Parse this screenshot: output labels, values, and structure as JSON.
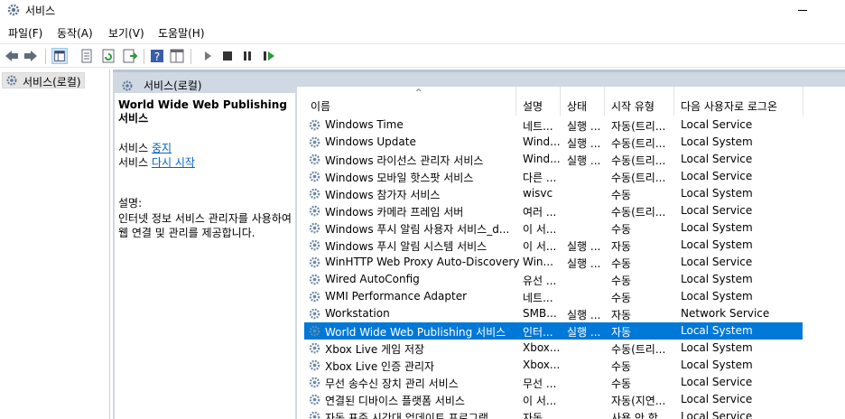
{
  "window": {
    "title": "서비스",
    "icon": "gear-icon"
  },
  "menu": [
    "파일(F)",
    "동작(A)",
    "보기(V)",
    "도움말(H)"
  ],
  "toolbar": [
    "back-arrow-icon",
    "forward-arrow-icon",
    "console-tree-icon",
    "properties-icon",
    "refresh-icon",
    "export-list-icon",
    "help-icon",
    "view-icon",
    "start-icon",
    "stop-icon",
    "pause-icon",
    "restart-icon"
  ],
  "tree": {
    "root_label": "서비스(로컬)"
  },
  "pane": {
    "title": "서비스(로컬)"
  },
  "extended": {
    "service_name": "World Wide Web Publishing 서비스",
    "action_prefix": "서비스",
    "stop_link": "중지",
    "restart_link": "다시 시작",
    "desc_label": "설명:",
    "description": "인터넷 정보 서비스 관리자를 사용하여 웹 연결 및 관리를 제공합니다."
  },
  "columns": {
    "name": "이름",
    "desc": "설명",
    "status": "상태",
    "startup": "시작 유형",
    "logon": "다음 사용자로 로그온"
  },
  "rows": [
    {
      "name": "Windows Time",
      "desc": "네트...",
      "status": "실행 ...",
      "startup": "자동(트리...",
      "logon": "Local Service"
    },
    {
      "name": "Windows Update",
      "desc": "Wind...",
      "status": "실행 ...",
      "startup": "수동(트리...",
      "logon": "Local System"
    },
    {
      "name": "Windows 라이선스 관리자 서비스",
      "desc": "Wind...",
      "status": "실행 ...",
      "startup": "수동(트리...",
      "logon": "Local Service"
    },
    {
      "name": "Windows 모바일 핫스팟 서비스",
      "desc": "다른 ...",
      "status": "",
      "startup": "수동(트리...",
      "logon": "Local Service"
    },
    {
      "name": "Windows 참가자 서비스",
      "desc": "wisvc",
      "status": "",
      "startup": "수동",
      "logon": "Local System"
    },
    {
      "name": "Windows 카메라 프레임 서버",
      "desc": "여러 ...",
      "status": "",
      "startup": "수동(트리...",
      "logon": "Local Service"
    },
    {
      "name": "Windows 푸시 알림 사용자 서비스_d...",
      "desc": "이 서...",
      "status": "",
      "startup": "수동",
      "logon": "Local System"
    },
    {
      "name": "Windows 푸시 알림 시스템 서비스",
      "desc": "이 서...",
      "status": "실행 ...",
      "startup": "자동",
      "logon": "Local System"
    },
    {
      "name": "WinHTTP Web Proxy Auto-Discovery ...",
      "desc": "Win...",
      "status": "실행 ...",
      "startup": "수동",
      "logon": "Local Service"
    },
    {
      "name": "Wired AutoConfig",
      "desc": "유선 ...",
      "status": "",
      "startup": "수동",
      "logon": "Local System"
    },
    {
      "name": "WMI Performance Adapter",
      "desc": "네트...",
      "status": "",
      "startup": "수동",
      "logon": "Local System"
    },
    {
      "name": "Workstation",
      "desc": "SMB...",
      "status": "실행 ...",
      "startup": "자동",
      "logon": "Network Service"
    },
    {
      "name": "World Wide Web Publishing 서비스",
      "desc": "인터...",
      "status": "실행 ...",
      "startup": "자동",
      "logon": "Local System",
      "selected": true
    },
    {
      "name": "Xbox Live 게임 저장",
      "desc": "Xbox...",
      "status": "",
      "startup": "수동(트리...",
      "logon": "Local System"
    },
    {
      "name": "Xbox Live 인증 관리자",
      "desc": "Xbox...",
      "status": "",
      "startup": "수동",
      "logon": "Local System"
    },
    {
      "name": "무선 송수신 장치 관리 서비스",
      "desc": "무선 ...",
      "status": "",
      "startup": "수동",
      "logon": "Local Service"
    },
    {
      "name": "연결된 디바이스 플랫폼 서비스",
      "desc": "이 서...",
      "status": "",
      "startup": "자동(지연...",
      "logon": "Local Service"
    },
    {
      "name": "자동 표준 시간대 업데이트 프로그램",
      "desc": "자동 ...",
      "status": "",
      "startup": "사용 안 함",
      "logon": "Local Service"
    }
  ],
  "colors": {
    "selection": "#0078d7",
    "pane_header": "#cfd8e3",
    "link": "#0563c1"
  }
}
